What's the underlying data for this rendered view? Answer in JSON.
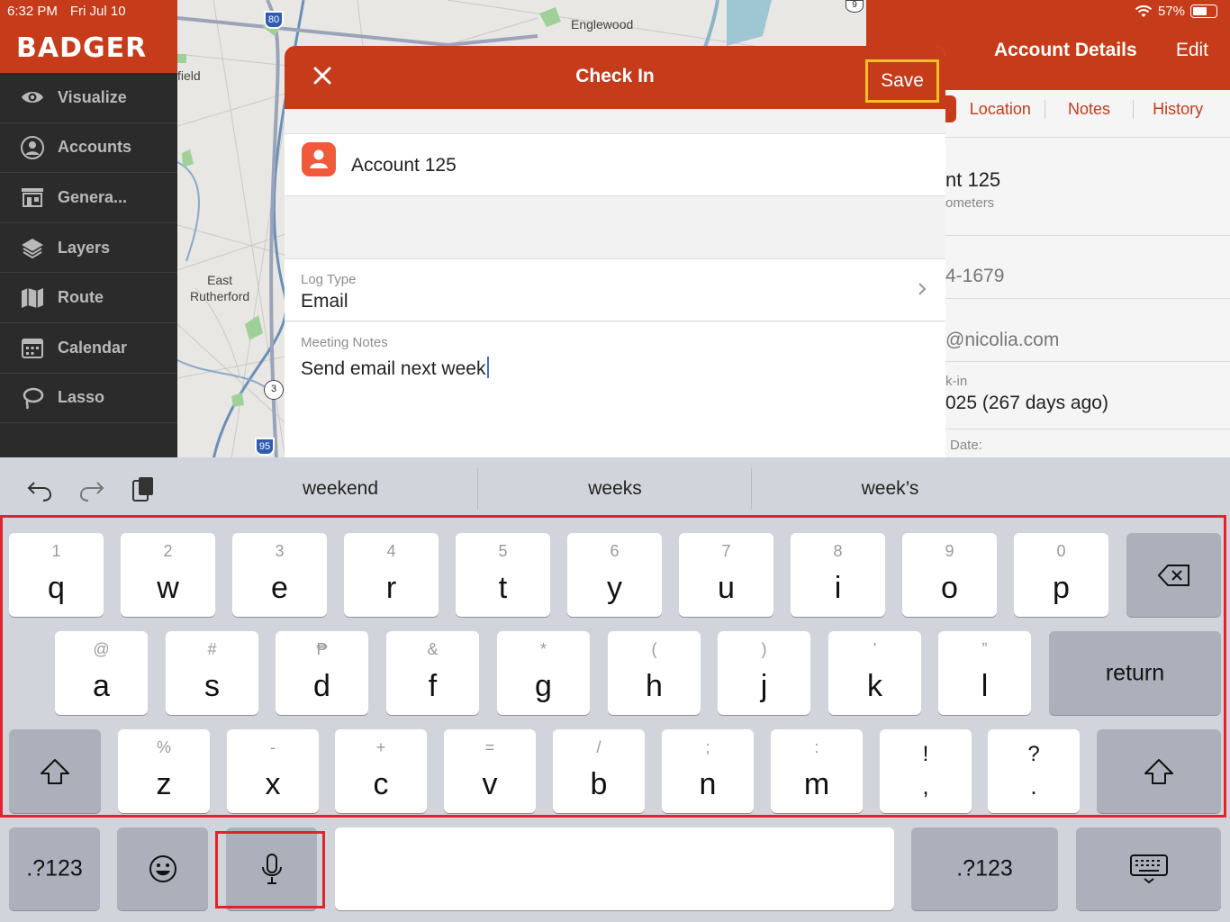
{
  "status": {
    "time": "6:32 PM",
    "date": "Fri Jul 10",
    "battery": "57%"
  },
  "sidebar": {
    "brand": "BADGER",
    "items": [
      {
        "label": "Visualize",
        "icon": "eye-icon"
      },
      {
        "label": "Accounts",
        "icon": "person-circle-icon"
      },
      {
        "label": "Genera...",
        "icon": "storefront-icon"
      },
      {
        "label": "Layers",
        "icon": "layers-icon"
      },
      {
        "label": "Route",
        "icon": "map-route-icon"
      },
      {
        "label": "Calendar",
        "icon": "calendar-icon"
      },
      {
        "label": "Lasso",
        "icon": "lasso-icon"
      }
    ]
  },
  "map": {
    "labels": {
      "englewood": "Englewood",
      "field": "field",
      "east_rutherford": "East\nRutherford"
    },
    "shields": {
      "i80": "80",
      "r3": "3",
      "i95": "95",
      "r9": "9"
    }
  },
  "panel": {
    "title": "Account Details",
    "edit": "Edit",
    "tabs": [
      "Location",
      "Notes",
      "History"
    ],
    "name_partial": "nt 125",
    "distance_partial": "ometers",
    "phone_partial": "4-1679",
    "email_partial": "@nicolia.com",
    "checkin_label_partial": "k-in",
    "checkin_value_partial": "025 (267 days ago)",
    "date_label_partial": "Date:"
  },
  "modal": {
    "title": "Check In",
    "save": "Save",
    "account_name": "Account 125",
    "log_type_label": "Log Type",
    "log_type_value": "Email",
    "notes_label": "Meeting Notes",
    "notes_value": "Send email next week"
  },
  "keyboard": {
    "suggestions": [
      "weekend",
      "weeks",
      "week’s"
    ],
    "row1": [
      {
        "main": "q",
        "sub": "1"
      },
      {
        "main": "w",
        "sub": "2"
      },
      {
        "main": "e",
        "sub": "3"
      },
      {
        "main": "r",
        "sub": "4"
      },
      {
        "main": "t",
        "sub": "5"
      },
      {
        "main": "y",
        "sub": "6"
      },
      {
        "main": "u",
        "sub": "7"
      },
      {
        "main": "i",
        "sub": "8"
      },
      {
        "main": "o",
        "sub": "9"
      },
      {
        "main": "p",
        "sub": "0"
      }
    ],
    "row2": [
      {
        "main": "a",
        "sub": "@"
      },
      {
        "main": "s",
        "sub": "#"
      },
      {
        "main": "d",
        "sub": "₱"
      },
      {
        "main": "f",
        "sub": "&"
      },
      {
        "main": "g",
        "sub": "*"
      },
      {
        "main": "h",
        "sub": "("
      },
      {
        "main": "j",
        "sub": ")"
      },
      {
        "main": "k",
        "sub": "’"
      },
      {
        "main": "l",
        "sub": "”"
      }
    ],
    "row3": [
      {
        "main": "z",
        "sub": "%"
      },
      {
        "main": "x",
        "sub": "-"
      },
      {
        "main": "c",
        "sub": "+"
      },
      {
        "main": "v",
        "sub": "="
      },
      {
        "main": "b",
        "sub": "/"
      },
      {
        "main": "n",
        "sub": ";"
      },
      {
        "main": "m",
        "sub": ":"
      }
    ],
    "punct": [
      {
        "top": "!",
        "bottom": ","
      },
      {
        "top": "?",
        "bottom": "."
      }
    ],
    "return": "return",
    "numbers": ".?123"
  },
  "colors": {
    "brand": "#c63b1a",
    "highlight_yellow": "#f6c026",
    "highlight_red": "#e0242c"
  }
}
